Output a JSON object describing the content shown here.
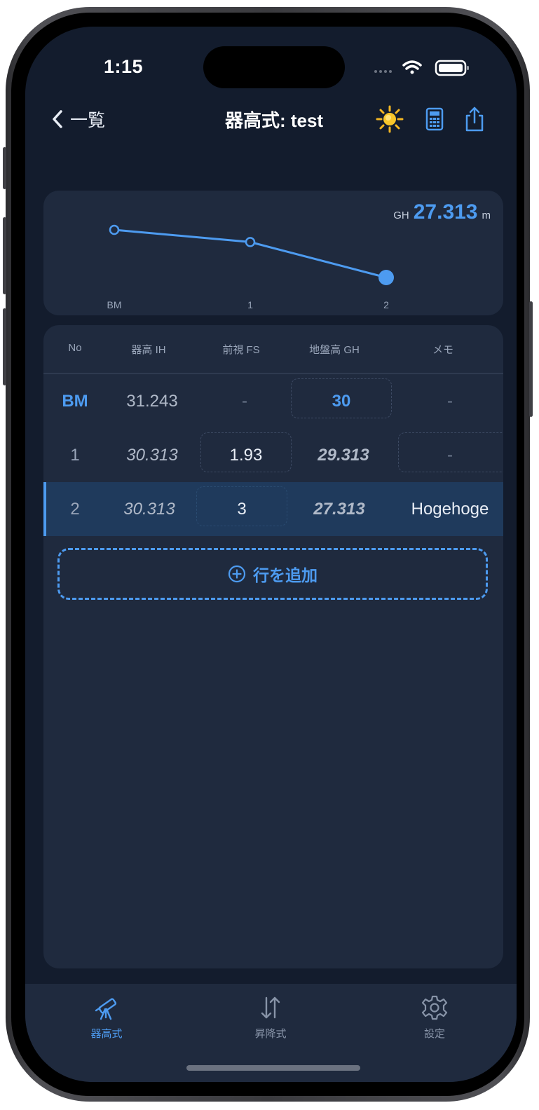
{
  "status": {
    "time": "1:15"
  },
  "nav": {
    "back_label": "一覧",
    "title": "器高式: test"
  },
  "chart_data": {
    "type": "line",
    "categories": [
      "BM",
      "1",
      "2"
    ],
    "series": [
      {
        "values": [
          30,
          29.313,
          27.313
        ]
      }
    ],
    "title": "",
    "xlabel": "",
    "ylabel": "",
    "highlight_index": 2
  },
  "readout": {
    "label": "GH",
    "value": "27.313",
    "unit": "m"
  },
  "table": {
    "headers": [
      "No",
      "器高 IH",
      "前視 FS",
      "地盤高 GH",
      "メモ"
    ],
    "rows": [
      {
        "no": "BM",
        "ih": "31.243",
        "fs": "-",
        "gh": "30",
        "memo": "-"
      },
      {
        "no": "1",
        "ih": "30.313",
        "fs": "1.93",
        "gh": "29.313",
        "memo": "-"
      },
      {
        "no": "2",
        "ih": "30.313",
        "fs": "3",
        "gh": "27.313",
        "memo": "Hogehoge"
      }
    ],
    "selected_row": 2,
    "add_label": "行を追加"
  },
  "tabs": [
    {
      "label": "器高式",
      "icon": "telescope-icon",
      "active": true
    },
    {
      "label": "昇降式",
      "icon": "up-down-arrows-icon",
      "active": false
    },
    {
      "label": "設定",
      "icon": "gear-icon",
      "active": false
    }
  ],
  "colors": {
    "accent": "#4d9bf0",
    "background": "#131c2d",
    "card": "#1f2a3e",
    "selected_row": "#1f3a5c"
  }
}
